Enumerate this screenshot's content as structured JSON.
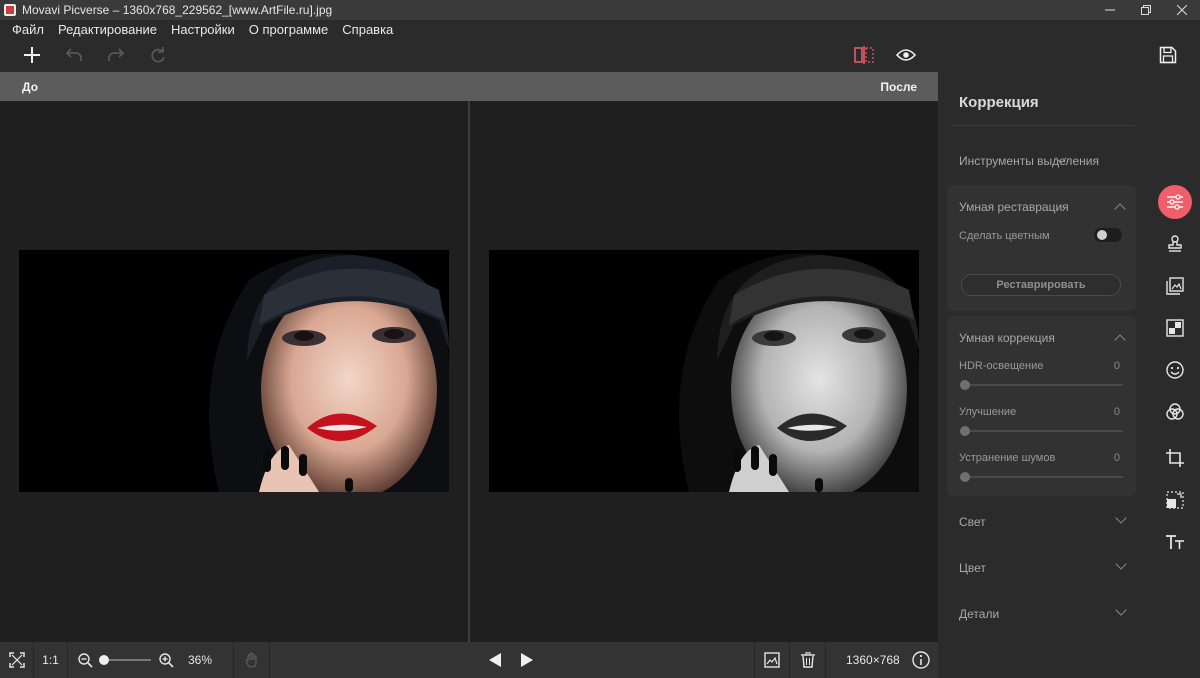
{
  "window": {
    "title": "Movavi Picverse – 1360x768_229562_[www.ArtFile.ru].jpg"
  },
  "menu": [
    "Файл",
    "Редактирование",
    "Настройки",
    "О программе",
    "Справка"
  ],
  "compare": {
    "before": "До",
    "after": "После"
  },
  "bottom": {
    "ratio": "1:1",
    "zoom": "36%",
    "size": "1360×768"
  },
  "zoom_level": 0.0,
  "panel": {
    "title": "Коррекция",
    "selection_tools": "Инструменты выделения",
    "smart_restore": {
      "title": "Умная реставрация",
      "colorize": "Сделать цветным",
      "colorize_on": false,
      "button": "Реставрировать"
    },
    "smart_correction": {
      "title": "Умная коррекция",
      "sliders": [
        {
          "label": "HDR-освещение",
          "value": "0"
        },
        {
          "label": "Улучшение",
          "value": "0"
        },
        {
          "label": "Устранение шумов",
          "value": "0"
        }
      ]
    },
    "light": "Свет",
    "color": "Цвет",
    "details": "Детали"
  },
  "rail": [
    "sliders-icon",
    "stamp-icon",
    "image-replace-icon",
    "checker-icon",
    "face-icon",
    "color-circles-icon",
    "crop-icon",
    "resize-icon",
    "text-icon"
  ],
  "colors": {
    "accent": "#ef5e6a",
    "compare_icon": "#e85a62"
  }
}
